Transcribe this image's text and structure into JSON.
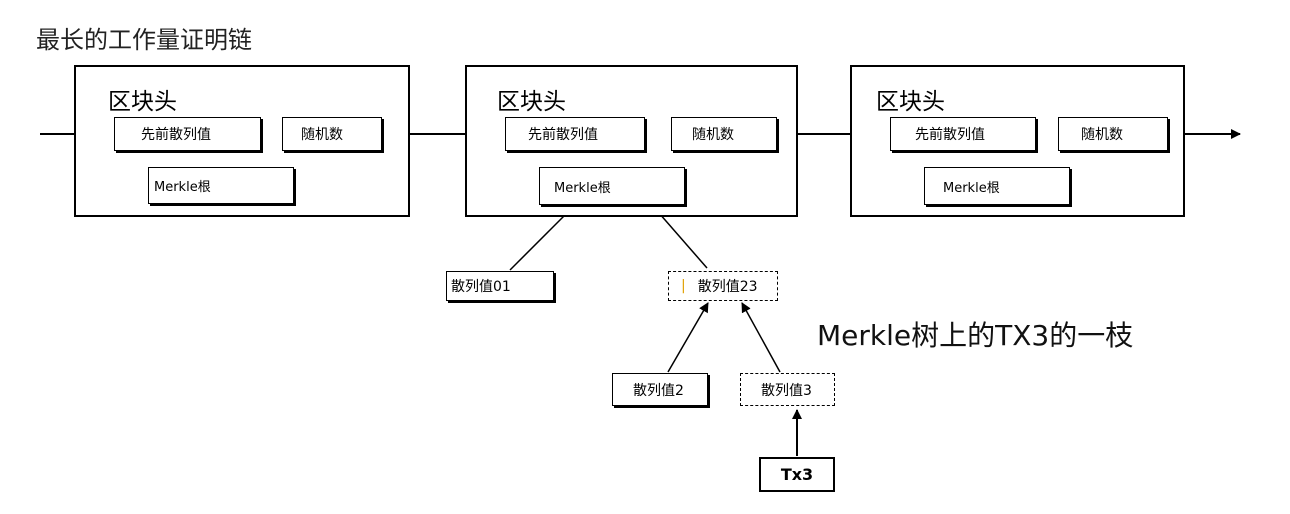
{
  "title": "最长的工作量证明链",
  "blocks": [
    {
      "label": "区块头",
      "prev_hash": "先前散列值",
      "nonce": "随机数",
      "merkle_root": "Merkle根"
    },
    {
      "label": "区块头",
      "prev_hash": "先前散列值",
      "nonce": "随机数",
      "merkle_root": "Merkle根"
    },
    {
      "label": "区块头",
      "prev_hash": "先前散列值",
      "nonce": "随机数",
      "merkle_root": "Merkle根"
    }
  ],
  "merkle_tree": {
    "hash01": "散列值01",
    "hash23": "散列值23",
    "hash2": "散列值2",
    "hash3": "散列值3",
    "tx3": "Tx3"
  },
  "caption": "Merkle树上的TX3的一枝"
}
